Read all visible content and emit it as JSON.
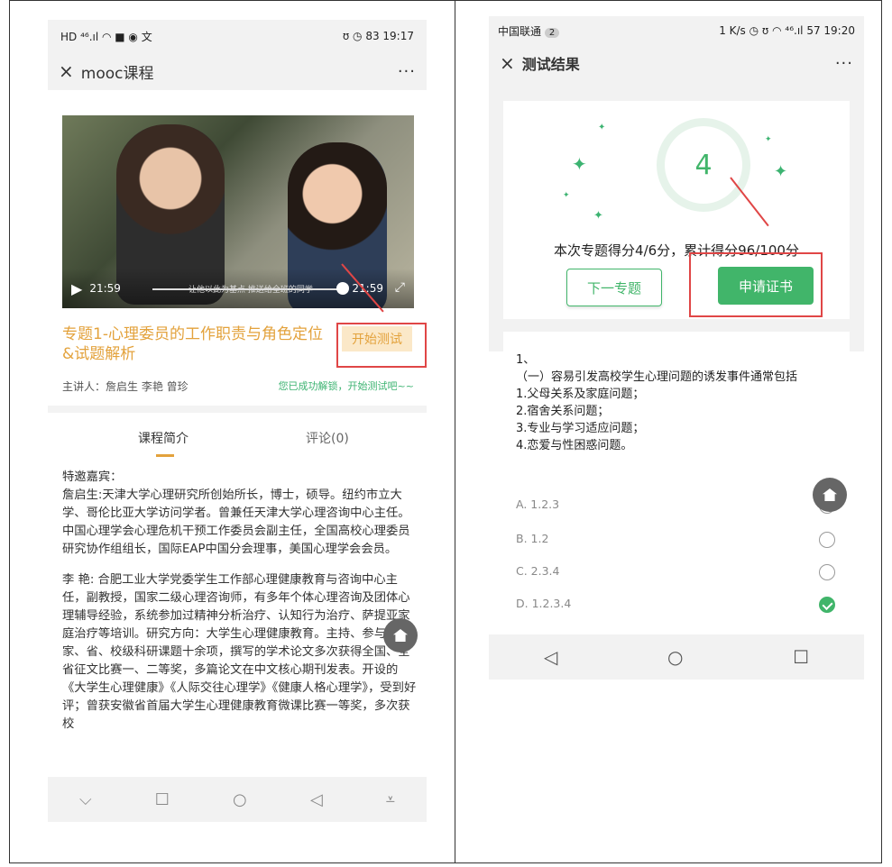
{
  "left": {
    "status": {
      "left_icons": "HD ⁴⁶.ıl ◠ ■ ◉ 文",
      "right": "ʊ ◷ 83 19:17"
    },
    "titlebar": {
      "close": "×",
      "title": "mooc课程",
      "more": "···"
    },
    "video": {
      "time_left": "21:59",
      "time_right": "21:59",
      "subtitle": "让他以此为基点 推送给全班的同学"
    },
    "course": {
      "title": "专题1-心理委员的工作职责与角色定位&试题解析",
      "start_button": "开始测试",
      "lecturers": "主讲人：詹启生 李艳 曾珍",
      "unlock_msg": "您已成功解锁，开始测试吧~~"
    },
    "tabs": [
      {
        "label": "课程简介"
      },
      {
        "label": "评论(0)"
      }
    ],
    "intro": {
      "p1": "特邀嘉宾：\n詹启生:天津大学心理研究所创始所长，博士，硕导。纽约市立大学、哥伦比亚大学访问学者。曾兼任天津大学心理咨询中心主任。中国心理学会心理危机干预工作委员会副主任，全国高校心理委员研究协作组组长，国际EAP中国分会理事，美国心理学会会员。",
      "p2": "李 艳: 合肥工业大学党委学生工作部心理健康教育与咨询中心主任，副教授，国家二级心理咨询师，有多年个体心理咨询及团体心理辅导经验，系统参加过精神分析治疗、认知行为治疗、萨提亚家庭治疗等培训。研究方向：大学生心理健康教育。主持、参与国家、省、校级科研课题十余项，撰写的学术论文多次获得全国、全省征文比赛一、二等奖，多篇论文在中文核心期刊发表。开设的《大学生心理健康》《人际交往心理学》《健康人格心理学》，受到好评；曾获安徽省首届大学生心理健康教育微课比赛一等奖，多次获校"
    },
    "navbar": {
      "b1": "⌵",
      "b2": "☐",
      "b3": "○",
      "b4": "◁",
      "b5": "⩡"
    }
  },
  "right": {
    "status": {
      "carrier": "中国联通",
      "sim": "2",
      "right": "1 K/s ◷ ʊ ◠ ⁴⁶.ıl 57 19:20"
    },
    "titlebar": {
      "close": "×",
      "title": "测试结果",
      "more": "···"
    },
    "score": {
      "value": "4",
      "text": "本次专题得分4/6分，累计得分96/100分"
    },
    "buttons": {
      "next": "下一专题",
      "certificate": "申请证书"
    },
    "question": {
      "text": "1、\n（一）容易引发高校学生心理问题的诱发事件通常包括\n1.父母关系及家庭问题；\n2.宿舍关系问题；\n3.专业与学习适应问题；\n4.恋爱与性困惑问题。",
      "options": [
        {
          "label": "A. 1.2.3",
          "selected": false
        },
        {
          "label": "B. 1.2",
          "selected": false
        },
        {
          "label": "C. 2.3.4",
          "selected": false
        },
        {
          "label": "D. 1.2.3.4",
          "selected": true
        }
      ]
    },
    "navbar": {
      "b1": "◁",
      "b2": "○",
      "b3": "☐"
    }
  },
  "colors": {
    "accent_orange": "#e3a23c",
    "accent_green": "#41b56a",
    "highlight_red": "#e04646"
  }
}
